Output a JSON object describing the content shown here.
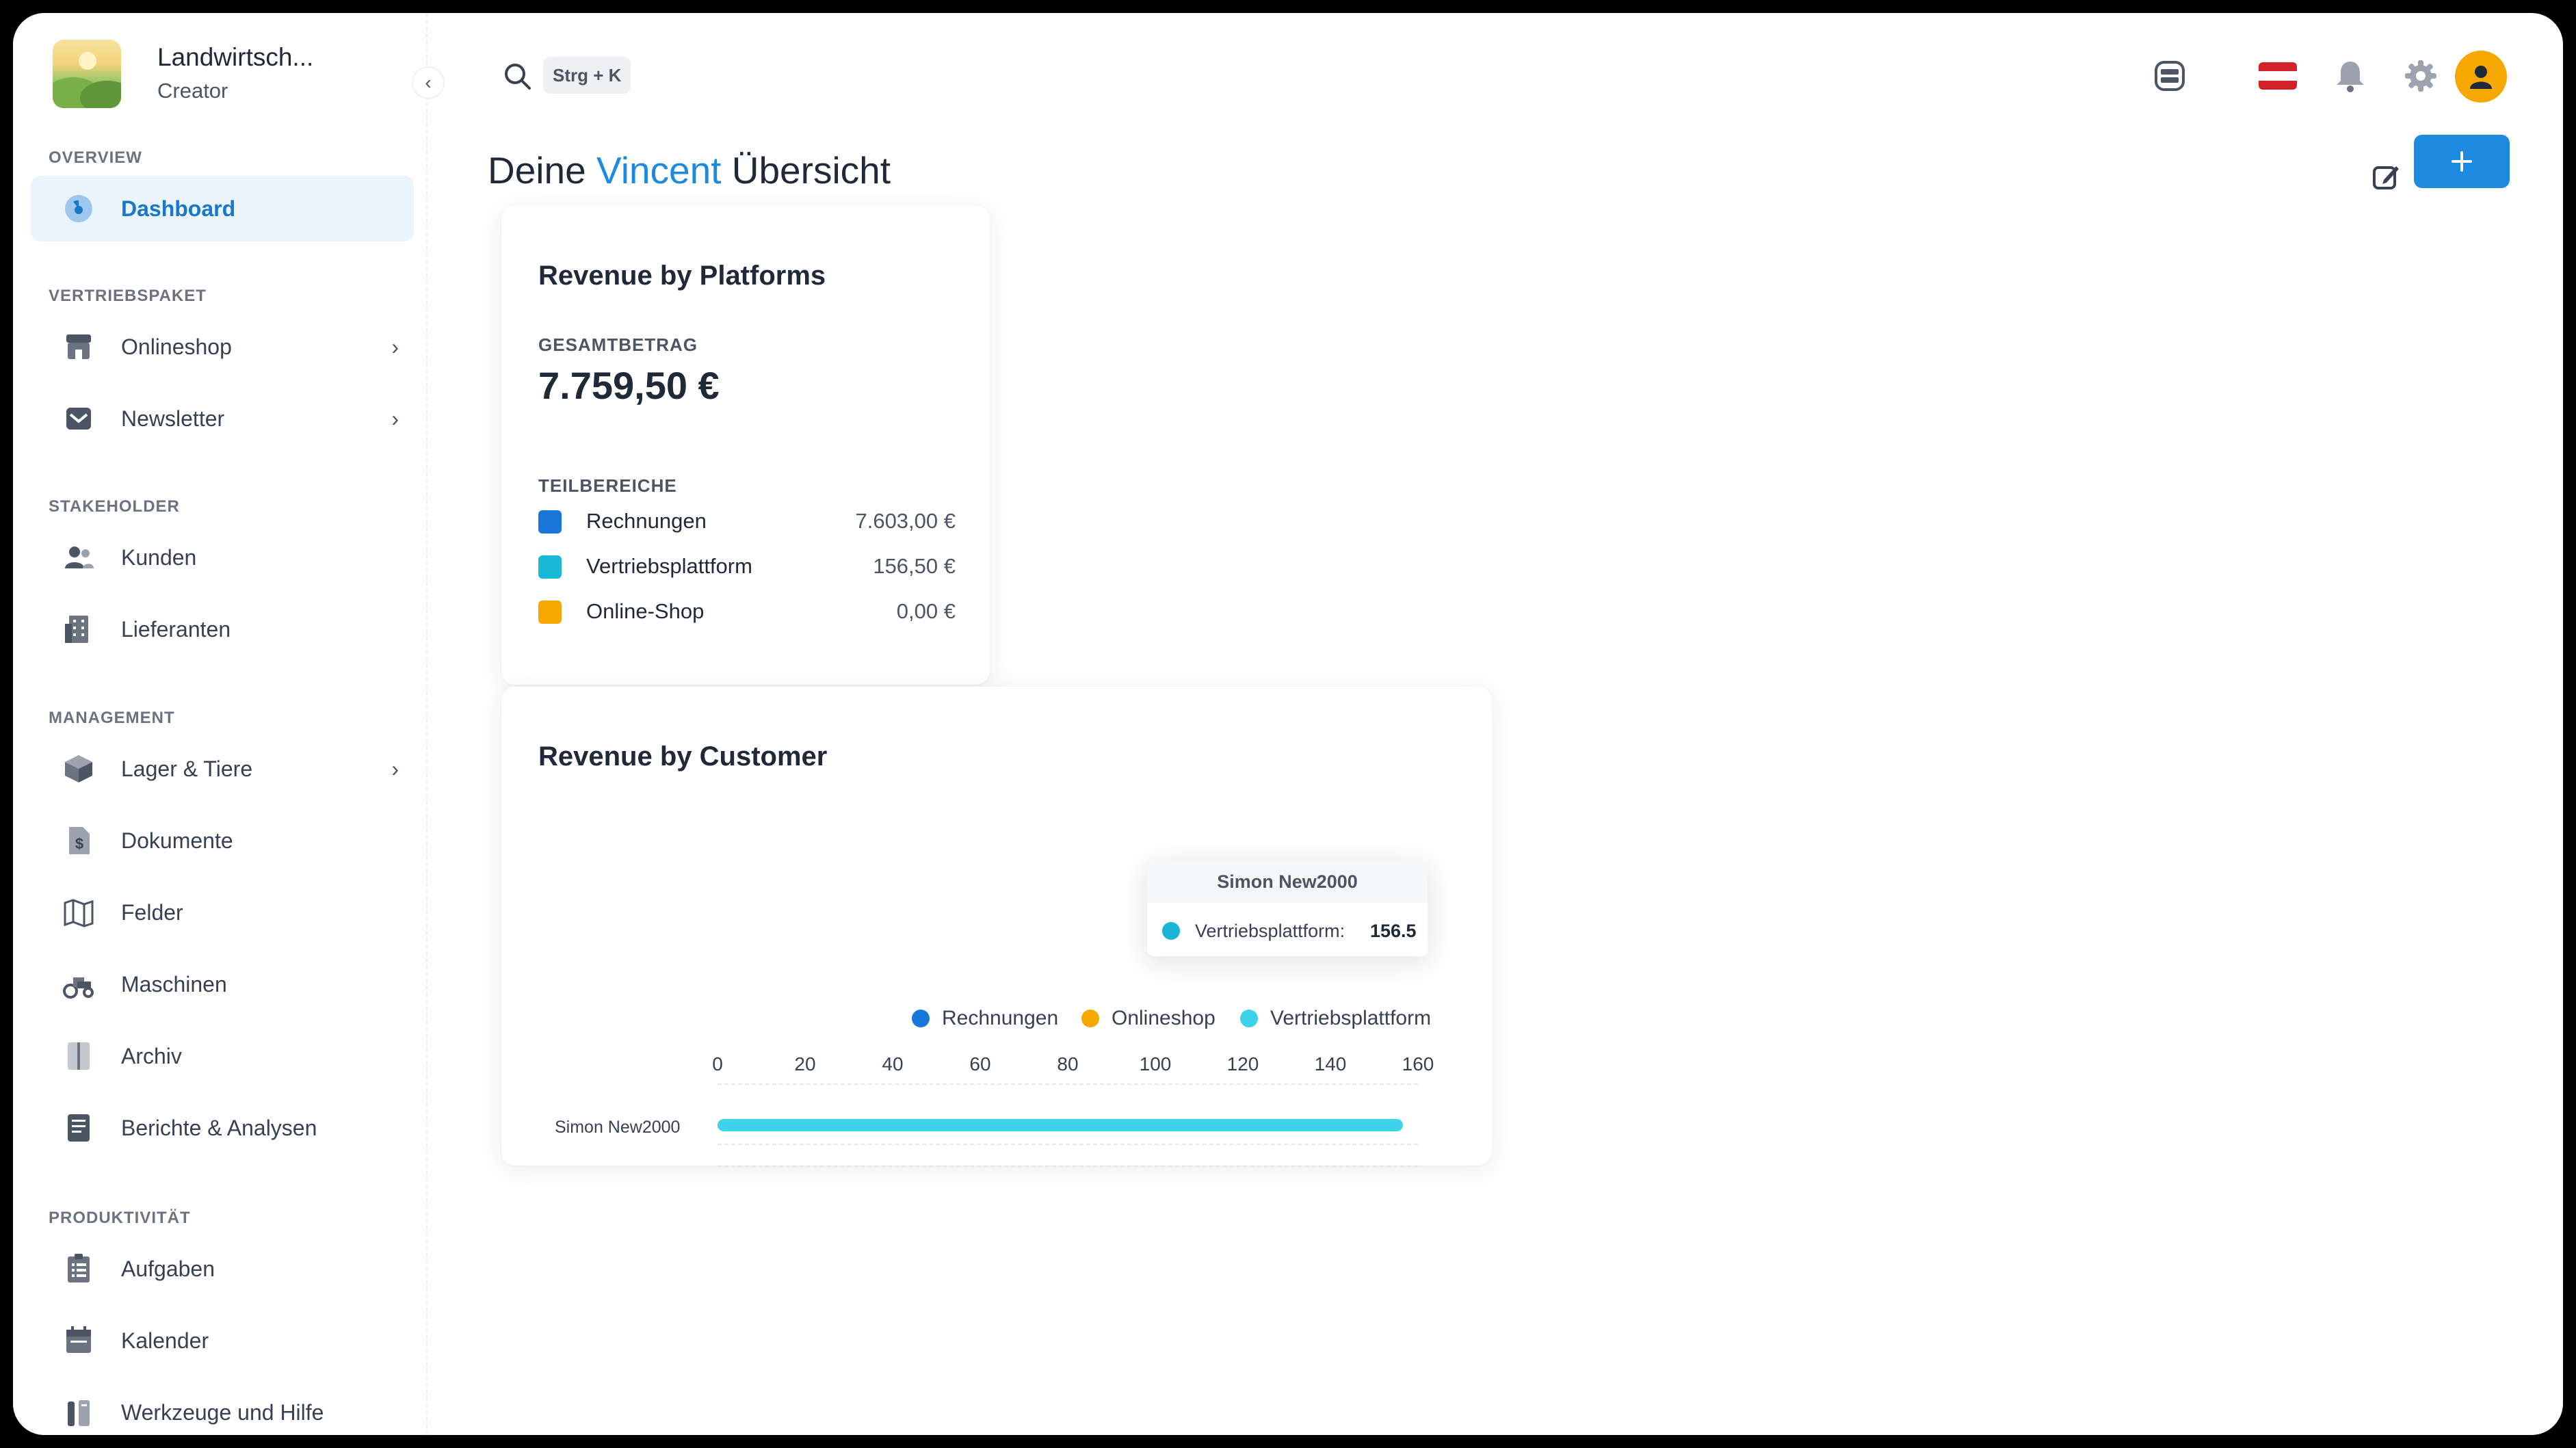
{
  "brand": {
    "name": "Landwirtsch...",
    "role": "Creator"
  },
  "sidebar": {
    "sections": {
      "overview": "OVERVIEW",
      "vertriebspaket": "VERTRIEBSPAKET",
      "stakeholder": "STAKEHOLDER",
      "management": "MANAGEMENT",
      "produktivitaet": "PRODUKTIVITÄT"
    },
    "items": [
      {
        "label": "Dashboard",
        "icon": "gauge-icon",
        "active": true
      },
      {
        "label": "Onlineshop",
        "icon": "store-icon",
        "has_submenu": true
      },
      {
        "label": "Newsletter",
        "icon": "mail-icon",
        "has_submenu": true
      },
      {
        "label": "Kunden",
        "icon": "users-icon"
      },
      {
        "label": "Lieferanten",
        "icon": "building-icon"
      },
      {
        "label": "Lager & Tiere",
        "icon": "box-icon",
        "has_submenu": true
      },
      {
        "label": "Dokumente",
        "icon": "document-icon"
      },
      {
        "label": "Felder",
        "icon": "map-icon"
      },
      {
        "label": "Maschinen",
        "icon": "tractor-icon"
      },
      {
        "label": "Archiv",
        "icon": "archive-icon"
      },
      {
        "label": "Berichte & Analysen",
        "icon": "report-icon"
      },
      {
        "label": "Aufgaben",
        "icon": "tasks-icon"
      },
      {
        "label": "Kalender",
        "icon": "calendar-icon"
      },
      {
        "label": "Werkzeuge und Hilfe",
        "icon": "tools-icon"
      }
    ]
  },
  "topbar": {
    "search_shortcut": "Strg + K",
    "icons": [
      "support-icon",
      "austria-flag-icon",
      "bell-icon",
      "gear-icon",
      "user-avatar-icon"
    ]
  },
  "header": {
    "title_prefix": "Deine",
    "title_name": "Vincent",
    "title_suffix": "Übersicht"
  },
  "platforms_card": {
    "title": "Revenue by Platforms",
    "total_label": "GESAMTBETRAG",
    "total_value": "7.759,50 €",
    "breakdown_label": "TEILBEREICHE",
    "rows": [
      {
        "label": "Rechnungen",
        "value": "7.603,00 €",
        "color": "#1877d8"
      },
      {
        "label": "Vertriebsplattform",
        "value": "156,50 €",
        "color": "#19b8d6"
      },
      {
        "label": "Online-Shop",
        "value": "0,00 €",
        "color": "#f6a800"
      }
    ]
  },
  "customer_card": {
    "title": "Revenue by Customer"
  },
  "tooltip": {
    "title": "Simon New2000",
    "series": "Vertriebsplattform:",
    "value": "156.5"
  },
  "chart_data": {
    "type": "bar",
    "orientation": "horizontal",
    "categories": [
      "Simon New2000"
    ],
    "series": [
      {
        "name": "Rechnungen",
        "values": [
          0
        ],
        "color": "#1877d8"
      },
      {
        "name": "Onlineshop",
        "values": [
          0
        ],
        "color": "#f6a800"
      },
      {
        "name": "Vertriebsplattform",
        "values": [
          156.5
        ],
        "color": "#3dd3ea"
      }
    ],
    "xticks": [
      0,
      20,
      40,
      60,
      80,
      100,
      120,
      140,
      160
    ],
    "xlim": [
      0,
      160
    ],
    "legend_position": "top-right",
    "grid": true
  }
}
